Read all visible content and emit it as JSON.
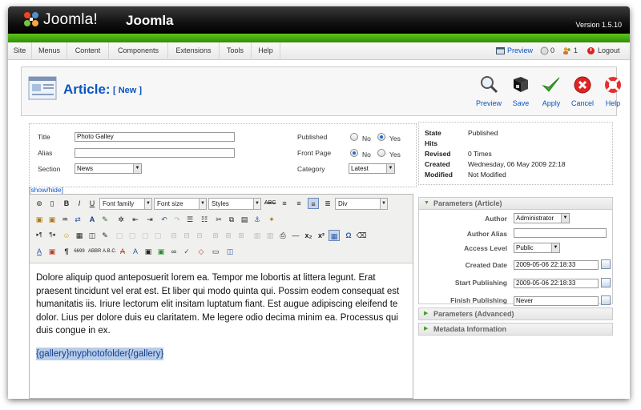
{
  "header": {
    "brand": "Joomla!",
    "site_name": "Joomla",
    "version": "Version 1.5.10"
  },
  "menu": [
    "Site",
    "Menus",
    "Content",
    "Components",
    "Extensions",
    "Tools",
    "Help"
  ],
  "status": {
    "preview": "Preview",
    "visitors": "0",
    "users": "1",
    "logout": "Logout"
  },
  "title": {
    "main": "Article:",
    "sub": "[ New ]"
  },
  "toolbar": {
    "preview": "Preview",
    "save": "Save",
    "apply": "Apply",
    "cancel": "Cancel",
    "help": "Help"
  },
  "form": {
    "title_label": "Title",
    "title_value": "Photo Galley",
    "alias_label": "Alias",
    "alias_value": "",
    "section_label": "Section",
    "section_value": "News",
    "published_label": "Published",
    "frontpage_label": "Front Page",
    "category_label": "Category",
    "category_value": "Latest",
    "no": "No",
    "yes": "Yes",
    "published": "yes",
    "frontpage": "no"
  },
  "state": {
    "state_label": "State",
    "state_value": "Published",
    "hits_label": "Hits",
    "hits_value": "",
    "revised_label": "Revised",
    "revised_value": "0 Times",
    "created_label": "Created",
    "created_value": "Wednesday, 06 May 2009 22:18",
    "modified_label": "Modified",
    "modified_value": "Not Modified"
  },
  "editor": {
    "show_hide": "[show/hide]",
    "font_family": "Font family",
    "font_size": "Font size",
    "styles": "Styles",
    "block": "Div",
    "body": "Dolore aliquip quod anteposuerit lorem ea. Tempor me lobortis at littera legunt. Erat praesent tincidunt vel erat est. Et liber qui modo quinta qui. Possim eodem consequat est humanitatis iis. Iriure lectorum elit insitam luptatum fiant. Est augue adipiscing eleifend te dolor. Lius per dolore duis eu claritatem. Me legere odio decima minim ea. Processus qui duis congue in ex.",
    "gallery_tag": "{gallery}myphotofolder{/gallery}"
  },
  "params": {
    "article_header": "Parameters (Article)",
    "author_label": "Author",
    "author_value": "Administrator",
    "author_alias_label": "Author Alias",
    "author_alias_value": "",
    "access_label": "Access Level",
    "access_value": "Public",
    "created_date_label": "Created Date",
    "created_date_value": "2009-05-06 22:18:33",
    "start_label": "Start Publishing",
    "start_value": "2009-05-06 22:18:33",
    "finish_label": "Finish Publishing",
    "finish_value": "Never",
    "advanced_header": "Parameters (Advanced)",
    "metadata_header": "Metadata Information"
  }
}
